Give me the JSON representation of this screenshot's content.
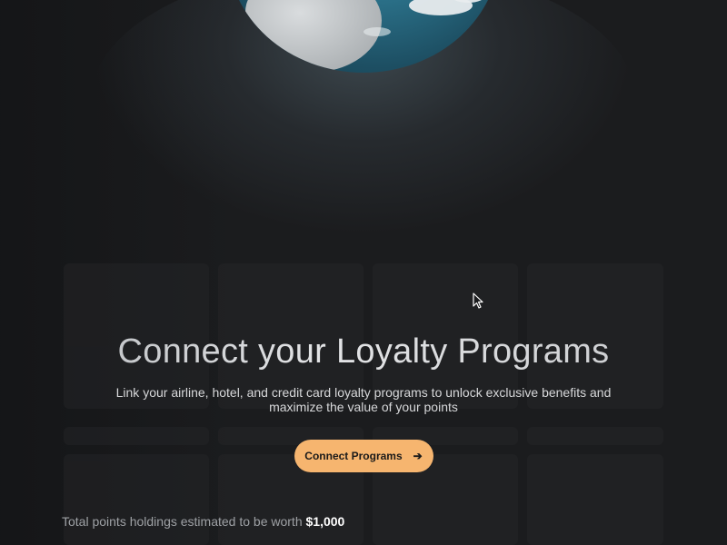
{
  "hero": {
    "title": "Connect your Loyalty Programs",
    "subtitle": "Link your airline, hotel, and credit card loyalty programs to unlock exclusive benefits and maximize the value of your points",
    "cta_label": "Connect Programs",
    "cta_icon": "arrow-right-icon"
  },
  "footer": {
    "holdings_text": "Total points holdings estimated to be worth",
    "holdings_value": "$1,000"
  },
  "colors": {
    "background": "#1b1c1e",
    "accent": "#f6b56f",
    "globe_ocean": "#2a6f87"
  }
}
